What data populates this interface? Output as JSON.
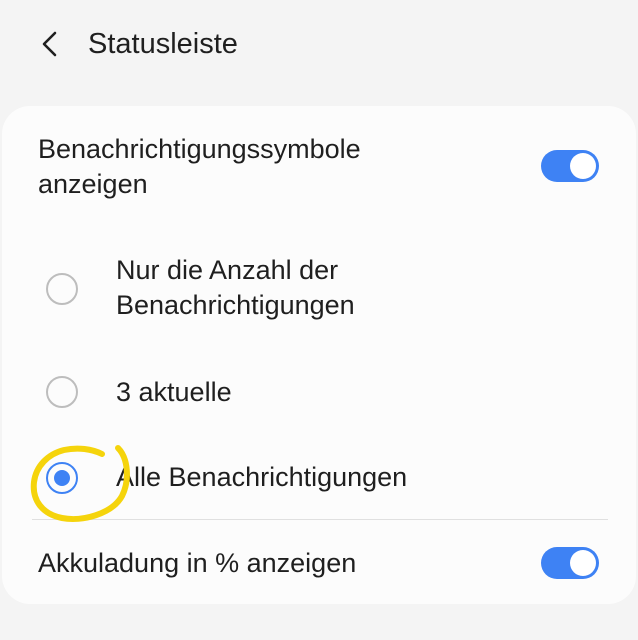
{
  "header": {
    "title": "Statusleiste"
  },
  "settings": {
    "notification_icons": {
      "label": "Benachrichtigungssymbole anzeigen",
      "enabled": true
    },
    "radio_options": [
      {
        "label": "Nur die Anzahl der Benachrichtigungen",
        "selected": false
      },
      {
        "label": "3 aktuelle",
        "selected": false
      },
      {
        "label": "Alle Benachrichtigungen",
        "selected": true
      }
    ],
    "battery_percentage": {
      "label": "Akkuladung in % anzeigen",
      "enabled": true
    }
  },
  "colors": {
    "accent": "#3e82f4",
    "highlight": "#f5d40c",
    "background": "#f4f4f4",
    "card": "#fcfcfc"
  },
  "icons": {
    "back": "chevron-left-icon"
  }
}
